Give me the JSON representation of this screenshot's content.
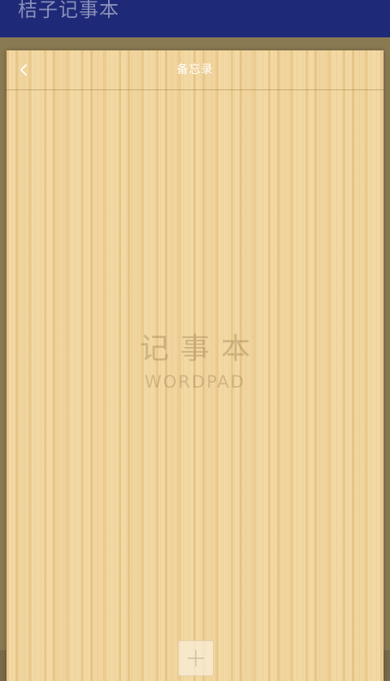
{
  "app": {
    "window_title": "桔子记事本"
  },
  "header": {
    "title": "备忘录",
    "back_icon": "chevron-left-icon"
  },
  "watermark": {
    "title_cn": "记事本",
    "title_en": "WORDPAD"
  },
  "actions": {
    "add_icon": "plus-icon"
  },
  "colors": {
    "app_titlebar": "#1e2a78",
    "backdrop": "#8a7a52",
    "wood": "#efd29a",
    "header_text": "#ffffff"
  }
}
